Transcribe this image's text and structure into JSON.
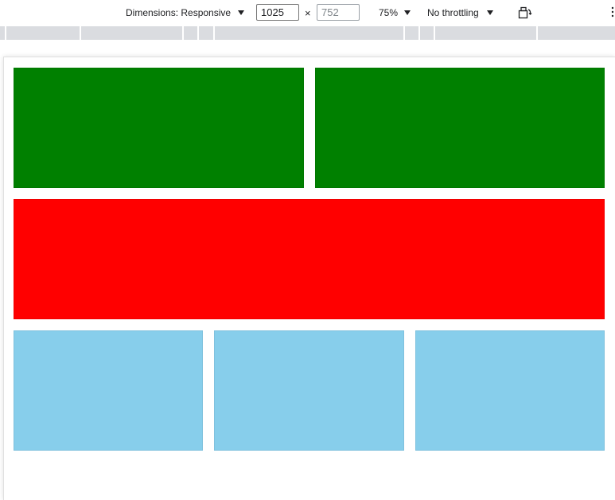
{
  "toolbar": {
    "dimensions_label": "Dimensions: Responsive",
    "width_value": "1025",
    "times_symbol": "×",
    "height_value": "752",
    "zoom_label": "75%",
    "throttling_label": "No throttling",
    "rotate_icon": "rotate-device-icon",
    "more_icon": "more-options-icon"
  },
  "rows": {
    "row1": {
      "color": "#008000",
      "count": 2
    },
    "row2": {
      "color": "#ff0000",
      "count": 1
    },
    "row3": {
      "color": "#87ceeb",
      "count": 3
    }
  }
}
